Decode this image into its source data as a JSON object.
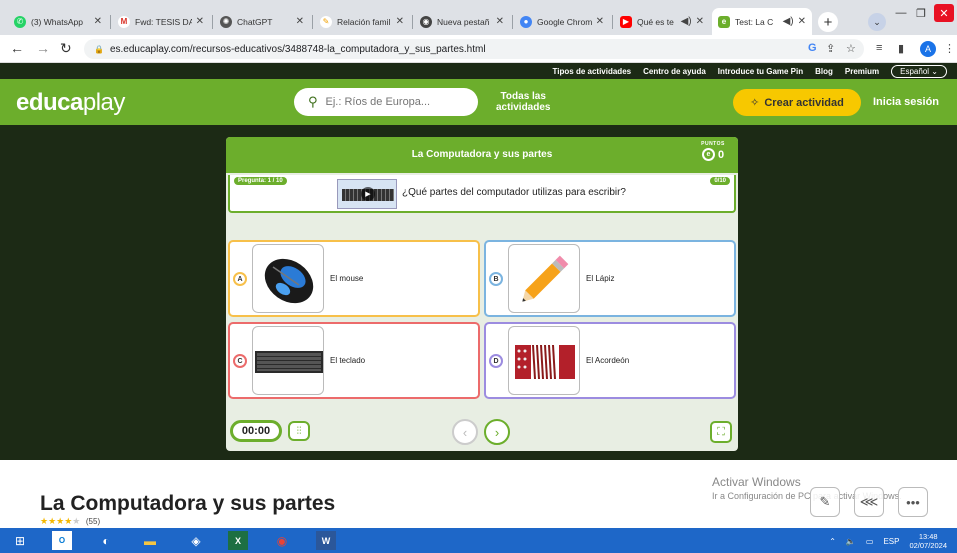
{
  "browser": {
    "tabs": [
      {
        "label": "(3) WhatsApp",
        "icon": "whatsapp-icon",
        "color": "#25d366"
      },
      {
        "label": "Fwd: TESIS DA",
        "icon": "gmail-icon",
        "color": "#d93025"
      },
      {
        "label": "ChatGPT",
        "icon": "chatgpt-icon",
        "color": "#555555"
      },
      {
        "label": "Relación famil",
        "icon": "relacion-icon",
        "color": "#f2a100"
      },
      {
        "label": "Nueva pestañ",
        "icon": "nueva-pestana-icon",
        "color": "#444444"
      },
      {
        "label": "Google Chrom",
        "icon": "chrome-icon",
        "color": "#4285f4"
      },
      {
        "label": "Qué es te",
        "icon": "youtube-icon",
        "color": "#ff0000"
      },
      {
        "label": "Test: La C",
        "icon": "educaplay-tab-icon",
        "color": "#6cae2c"
      }
    ],
    "url": "es.educaplay.com/recursos-educativos/3488748-la_computadora_y_sus_partes.html",
    "profile_initial": "A"
  },
  "site": {
    "top_links": [
      "Tipos de actividades",
      "Centro de ayuda",
      "Introduce tu Game Pin",
      "Blog",
      "Premium"
    ],
    "language": "Español",
    "logo_part1": "educa",
    "logo_part2": "play",
    "search_placeholder": "Ej.: Ríos de Europa...",
    "todas_line1": "Todas las",
    "todas_line2": "actividades",
    "crear_label": "Crear actividad",
    "login_label": "Inicia sesión"
  },
  "quiz": {
    "title": "La Computadora y sus partes",
    "points_label": "PUNTOS",
    "points_value": "0",
    "question_tag": "Pregunta: 1 / 10",
    "question_count": "0/10",
    "question_text": "¿Qué partes del computador utilizas para escribir?",
    "options": [
      {
        "letter": "A",
        "label": "El mouse"
      },
      {
        "letter": "B",
        "label": "El Lápiz"
      },
      {
        "letter": "C",
        "label": "El teclado"
      },
      {
        "letter": "D",
        "label": "El Acordeón"
      }
    ],
    "timer": "00:00"
  },
  "page": {
    "title": "La Computadora y sus partes",
    "rating_count": "(55)",
    "watermark_line1": "Activar Windows",
    "watermark_line2": "Ir a Configuración de PC para activar Windows."
  },
  "taskbar": {
    "lang": "ESP",
    "time": "13:48",
    "date": "02/07/2024"
  }
}
